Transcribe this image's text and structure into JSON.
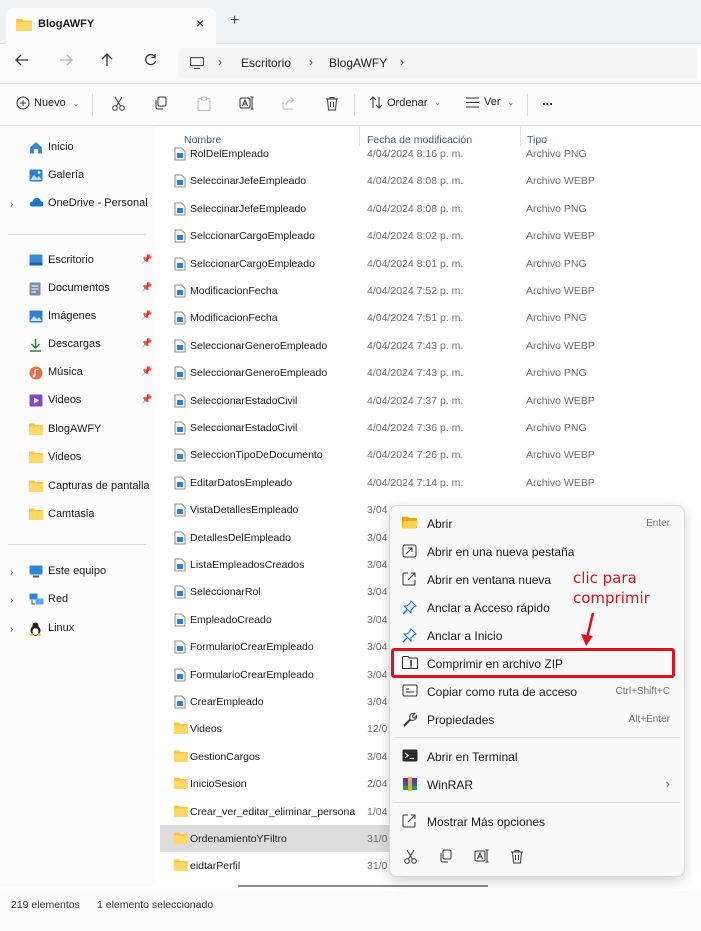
{
  "window": {
    "tab_title": "BlogAWFY",
    "tab_close": "×",
    "new_tab": "+"
  },
  "address": {
    "crumbs": [
      "Escritorio",
      "BlogAWFY"
    ],
    "separator": "›"
  },
  "commandbar": {
    "new_label": "Nuevo",
    "sort_label": "Ordenar",
    "view_label": "Ver",
    "more": "..."
  },
  "navpane": {
    "top_items": [
      {
        "label": "Inicio",
        "icon": "home-icon"
      },
      {
        "label": "Galería",
        "icon": "gallery-icon"
      },
      {
        "label": "OneDrive - Personal",
        "icon": "cloud-icon"
      }
    ],
    "quick_access": [
      {
        "label": "Escritorio",
        "icon": "desktop-icon",
        "pinned": true
      },
      {
        "label": "Documentos",
        "icon": "documents-icon",
        "pinned": true
      },
      {
        "label": "Imágenes",
        "icon": "pictures-icon",
        "pinned": true
      },
      {
        "label": "Descargas",
        "icon": "download-icon",
        "pinned": true
      },
      {
        "label": "Música",
        "icon": "music-icon",
        "pinned": true
      },
      {
        "label": "Videos",
        "icon": "videos-icon",
        "pinned": true
      },
      {
        "label": "BlogAWFY",
        "icon": "folder-icon",
        "pinned": false
      },
      {
        "label": "Videos",
        "icon": "folder-icon",
        "pinned": false
      },
      {
        "label": "Capturas de pantalla",
        "icon": "folder-icon",
        "pinned": false
      },
      {
        "label": "Camtasia",
        "icon": "folder-icon",
        "pinned": false
      }
    ],
    "devices": [
      {
        "label": "Este equipo",
        "icon": "computer-icon"
      },
      {
        "label": "Red",
        "icon": "network-icon"
      },
      {
        "label": "Linux",
        "icon": "linux-icon"
      }
    ]
  },
  "filelist": {
    "columns": [
      "Nombre",
      "Fecha de modificación",
      "Tipo"
    ],
    "rows": [
      {
        "name": "RolDelEmpleado",
        "date": "4/04/2024 8:16 p. m.",
        "type": "Archivo PNG",
        "kind": "file"
      },
      {
        "name": "SeleccinarJefeEmpleado",
        "date": "4/04/2024 8:08 p. m.",
        "type": "Archivo WEBP",
        "kind": "file"
      },
      {
        "name": "SeleccinarJefeEmpleado",
        "date": "4/04/2024 8:08 p. m.",
        "type": "Archivo PNG",
        "kind": "file"
      },
      {
        "name": "SelccionarCargoEmpleado",
        "date": "4/04/2024 8:02 p. m.",
        "type": "Archivo WEBP",
        "kind": "file"
      },
      {
        "name": "SelccionarCargoEmpleado",
        "date": "4/04/2024 8:01 p. m.",
        "type": "Archivo PNG",
        "kind": "file"
      },
      {
        "name": "ModificacionFecha",
        "date": "4/04/2024 7:52 p. m.",
        "type": "Archivo WEBP",
        "kind": "file"
      },
      {
        "name": "ModificacionFecha",
        "date": "4/04/2024 7:51 p. m.",
        "type": "Archivo PNG",
        "kind": "file"
      },
      {
        "name": "SeleccionarGeneroEmpleado",
        "date": "4/04/2024 7:43 p. m.",
        "type": "Archivo WEBP",
        "kind": "file"
      },
      {
        "name": "SeleccionarGeneroEmpleado",
        "date": "4/04/2024 7:43 p. m.",
        "type": "Archivo PNG",
        "kind": "file"
      },
      {
        "name": "SeleccionarEstadoCivil",
        "date": "4/04/2024 7:37 p. m.",
        "type": "Archivo WEBP",
        "kind": "file"
      },
      {
        "name": "SeleccionarEstadoCivil",
        "date": "4/04/2024 7:36 p. m.",
        "type": "Archivo PNG",
        "kind": "file"
      },
      {
        "name": "SeleccionTipoDeDocumento",
        "date": "4/04/2024 7:26 p. m.",
        "type": "Archivo WEBP",
        "kind": "file"
      },
      {
        "name": "EditarDatosEmpleado",
        "date": "4/04/2024 7:14 p. m.",
        "type": "Archivo WEBP",
        "kind": "file"
      },
      {
        "name": "VistaDetallesEmpleado",
        "date": "3/04",
        "type": "",
        "kind": "file"
      },
      {
        "name": "DetallesDelEmpleado",
        "date": "3/04",
        "type": "",
        "kind": "file"
      },
      {
        "name": "ListaEmpleadosCreados",
        "date": "3/04",
        "type": "",
        "kind": "file"
      },
      {
        "name": "SeleccionarRol",
        "date": "3/04",
        "type": "",
        "kind": "file"
      },
      {
        "name": "EmpleadoCreado",
        "date": "3/04",
        "type": "",
        "kind": "file"
      },
      {
        "name": "FormularioCrearEmpleado",
        "date": "3/04",
        "type": "",
        "kind": "file"
      },
      {
        "name": "FormularioCrearEmpleado",
        "date": "3/04",
        "type": "",
        "kind": "file"
      },
      {
        "name": "CrearEmpleado",
        "date": "3/04",
        "type": "",
        "kind": "file"
      },
      {
        "name": "Videos",
        "date": "12/0",
        "type": "",
        "kind": "folder"
      },
      {
        "name": "GestionCargos",
        "date": "3/04",
        "type": "",
        "kind": "folder"
      },
      {
        "name": "InicioSesion",
        "date": "2/04",
        "type": "",
        "kind": "folder"
      },
      {
        "name": "Crear_ver_editar_eliminar_persona",
        "date": "1/04",
        "type": "",
        "kind": "folder"
      },
      {
        "name": "OrdenamientoYFiltro",
        "date": "31/0",
        "type": "",
        "kind": "folder",
        "selected": true
      },
      {
        "name": "eidtarPerfil",
        "date": "31/0",
        "type": "",
        "kind": "folder"
      }
    ]
  },
  "context_menu": {
    "items": [
      {
        "label": "Abrir",
        "shortcut": "Enter",
        "icon": "folder-open-icon"
      },
      {
        "label": "Abrir en una nueva pestaña",
        "shortcut": "",
        "icon": "new-tab-icon"
      },
      {
        "label": "Abrir en ventana nueva",
        "shortcut": "",
        "icon": "new-window-icon"
      },
      {
        "label": "Anclar a Acceso rápido",
        "shortcut": "",
        "icon": "pin-icon"
      },
      {
        "label": "Anclar a Inicio",
        "shortcut": "",
        "icon": "pin-icon"
      },
      {
        "label": "Comprimir en archivo ZIP",
        "shortcut": "",
        "icon": "zip-icon",
        "highlighted": true
      },
      {
        "label": "Copiar como ruta de acceso",
        "shortcut": "Ctrl+Shift+C",
        "icon": "copy-path-icon"
      },
      {
        "label": "Propiedades",
        "shortcut": "Alt+Enter",
        "icon": "wrench-icon"
      },
      {
        "label": "Abrir en Terminal",
        "shortcut": "",
        "icon": "terminal-icon"
      },
      {
        "label": "WinRAR",
        "shortcut": "›",
        "icon": "winrar-icon"
      },
      {
        "label": "Mostrar Más opciones",
        "shortcut": "",
        "icon": "more-options-icon"
      }
    ]
  },
  "annotation": {
    "line1": "clic para",
    "line2": "comprimir",
    "color": "#e0101a"
  },
  "status": {
    "count": "219 elementos",
    "selection": "1 elemento seleccionado"
  },
  "colors": {
    "accent": "#0067c0",
    "folder": "#f4c542",
    "highlight": "#e0101a"
  }
}
